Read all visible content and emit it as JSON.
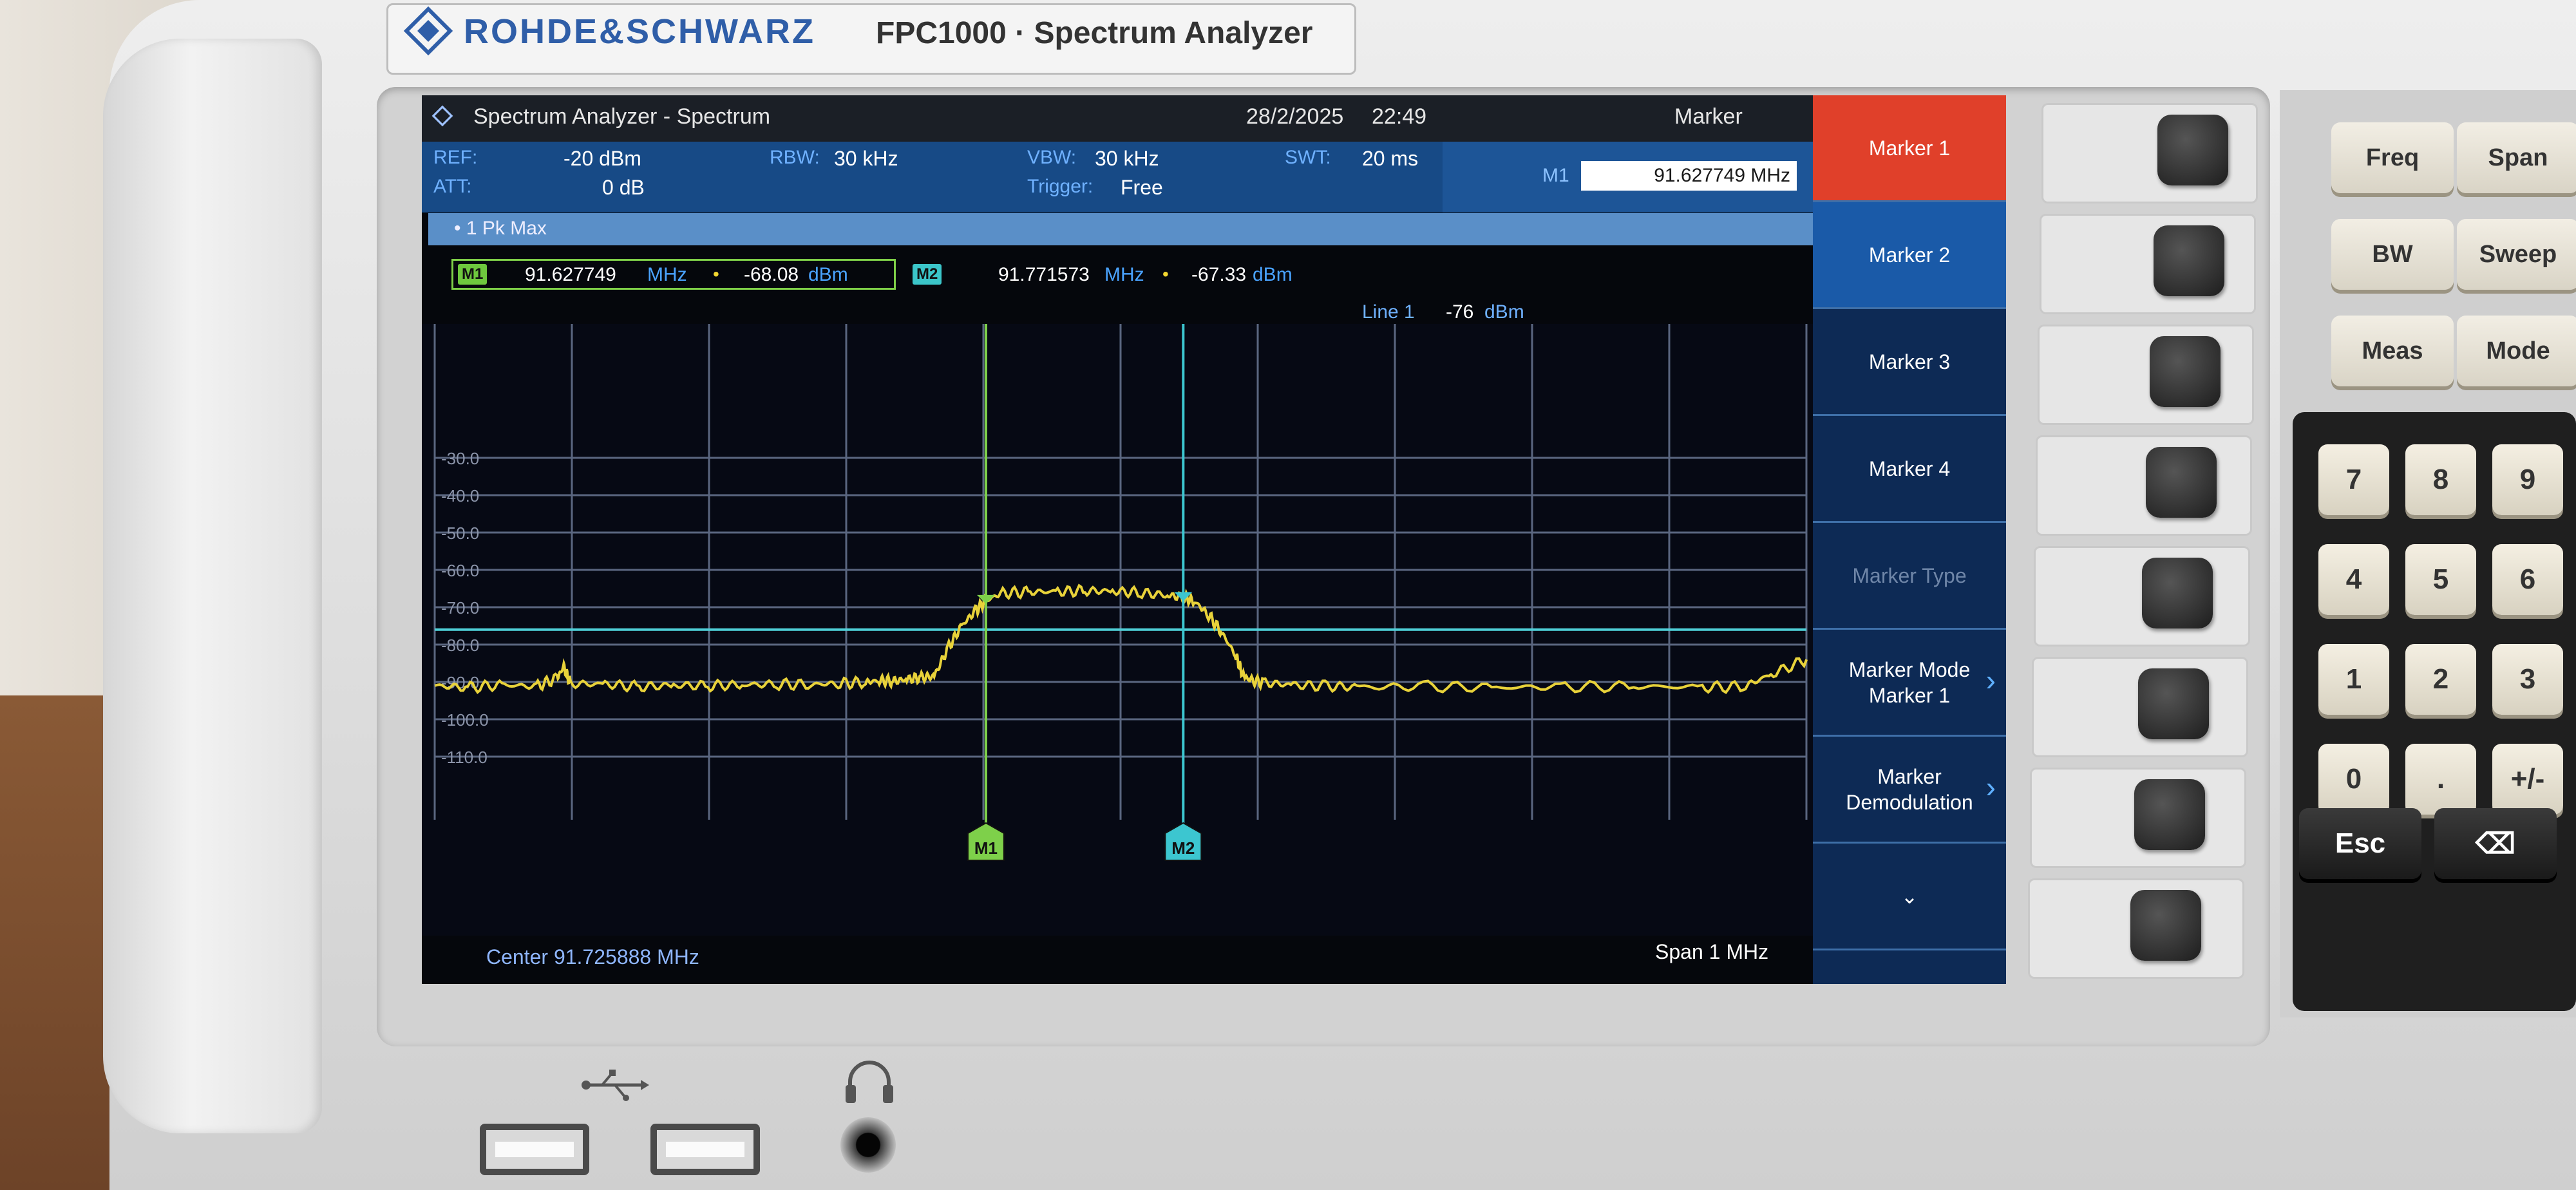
{
  "device": {
    "brand": "ROHDE&SCHWARZ",
    "model": "FPC1000 · Spectrum Analyzer"
  },
  "header": {
    "title": "Spectrum Analyzer - Spectrum",
    "date": "28/2/2025",
    "time": "22:49",
    "panel_title": "Marker"
  },
  "params": {
    "ref_label": "REF:",
    "ref_value": "-20 dBm",
    "att_label": "ATT:",
    "att_value": "0 dB",
    "rbw_label": "RBW:",
    "rbw_value": "30 kHz",
    "vbw_label": "VBW:",
    "vbw_value": "30 kHz",
    "swt_label": "SWT:",
    "swt_value": "20 ms",
    "trigger_label": "Trigger:",
    "trigger_value": "Free",
    "m1_label": "M1",
    "m1_value": "91.627749 MHz"
  },
  "trace_label": "• 1 Pk  Max",
  "readouts": {
    "m1": {
      "tag": "M1",
      "freq": "91.627749",
      "freq_unit": "MHz",
      "level": "-68.08",
      "level_unit": "dBm"
    },
    "m2": {
      "tag": "M2",
      "freq": "91.771573",
      "freq_unit": "MHz",
      "level": "-67.33",
      "level_unit": "dBm"
    }
  },
  "line": {
    "label": "Line 1",
    "value": "-76",
    "unit": "dBm"
  },
  "footer": {
    "center": "Center 91.725888 MHz",
    "span": "Span 1 MHz"
  },
  "softkeys": [
    {
      "label": "Marker 1",
      "state": "active"
    },
    {
      "label": "Marker 2",
      "state": "selected"
    },
    {
      "label": "Marker 3",
      "state": "normal"
    },
    {
      "label": "Marker 4",
      "state": "normal"
    },
    {
      "label": "Marker Type",
      "state": "disabled"
    },
    {
      "label": "Marker Mode\nMarker 1",
      "state": "normal",
      "chevron": true
    },
    {
      "label": "Marker\nDemodulation",
      "state": "normal",
      "chevron": true
    },
    {
      "label": "⌄",
      "state": "normal"
    }
  ],
  "keys": {
    "top": [
      "Freq",
      "Span",
      "BW",
      "Sweep",
      "Meas",
      "Mode"
    ],
    "numeric": [
      "7",
      "8",
      "9",
      "4",
      "5",
      "6",
      "1",
      "2",
      "3",
      "0",
      ".",
      "+/-"
    ],
    "bottom": [
      "Esc",
      "⌫"
    ]
  },
  "colors": {
    "trace": "#e8d23a",
    "marker1": "#7ed04a",
    "marker2": "#3cc6d0",
    "display_line": "#4fd0d8",
    "softkey_active": "#e0402a",
    "softkey_selected": "#1a5aa8",
    "screen_bg": "#05070c"
  },
  "chart_data": {
    "type": "line",
    "title": "",
    "xlabel": "",
    "ylabel": "",
    "y_tick_labels": [
      "-30.0",
      "-40.0",
      "-50.0",
      "-60.0",
      "-70.0",
      "-80.0",
      "-90.0",
      "-100.0",
      "-110.0"
    ],
    "ylim": [
      -120,
      -20
    ],
    "xlim_mhz": [
      91.225888,
      92.225888
    ],
    "grid": true,
    "series": [
      {
        "x": [
          91.226,
          91.25,
          91.275,
          91.3,
          91.315,
          91.32,
          91.325,
          91.35,
          91.375,
          91.4,
          91.425,
          91.45,
          91.475,
          91.5,
          91.52,
          91.54,
          91.55,
          91.56,
          91.57,
          91.58,
          91.59,
          91.6,
          91.61,
          91.62,
          91.628,
          91.64,
          91.66,
          91.68,
          91.7,
          91.72,
          91.74,
          91.76,
          91.772,
          91.78,
          91.79,
          91.8,
          91.81,
          91.815,
          91.82,
          91.83,
          91.85,
          91.875,
          91.9,
          91.95,
          92.0,
          92.05,
          92.1,
          92.15,
          92.18,
          92.2,
          92.226
        ],
        "y": [
          -91,
          -91.5,
          -90.8,
          -91.2,
          -89,
          -86,
          -90.5,
          -90.6,
          -91.3,
          -90.9,
          -91,
          -90.8,
          -90.6,
          -90.7,
          -90.4,
          -90.1,
          -89.6,
          -89.8,
          -89.3,
          -88.8,
          -88.5,
          -81,
          -75,
          -71,
          -68.1,
          -66.2,
          -65.9,
          -65.8,
          -65.6,
          -65.7,
          -66.1,
          -66.8,
          -67.3,
          -68.5,
          -72,
          -77,
          -83,
          -88,
          -89.5,
          -90.2,
          -90.8,
          -91.1,
          -91.4,
          -91.2,
          -91.5,
          -91.3,
          -91.2,
          -91.4,
          -91.3,
          -88,
          -84
        ]
      }
    ],
    "markers": [
      {
        "name": "M1",
        "x": 91.627749,
        "y": -68.08
      },
      {
        "name": "M2",
        "x": 91.771573,
        "y": -67.33
      }
    ],
    "display_line": {
      "name": "Line 1",
      "y": -76
    }
  }
}
